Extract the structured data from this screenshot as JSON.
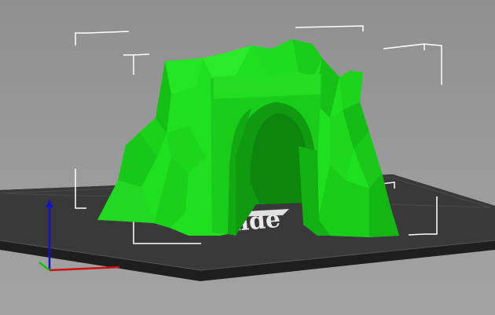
{
  "viewport": {
    "background_color": "#9a9a9a",
    "bed_color": "#3a3a3a",
    "bed_edge_color": "#1c1c1c",
    "bed_logo_text": "nde",
    "model_color": "#1fe01f",
    "bounding_box_color": "#ffffff",
    "axis_colors": {
      "x": "#d01010",
      "y": "#10c010",
      "z": "#1010c0"
    }
  }
}
